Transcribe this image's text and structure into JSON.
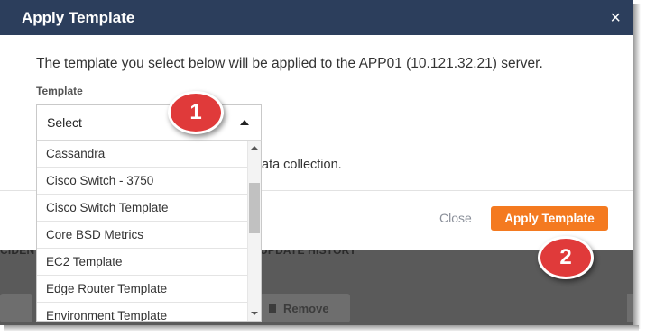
{
  "background": {
    "tab_left": "CIDENT",
    "tab_right": "UPDATE HISTORY",
    "remove_label": "Remove"
  },
  "dialog": {
    "title": "Apply Template",
    "close_icon": "×",
    "description": "The template you select below will be applied to the APP01 (10.121.32.21) server.",
    "field_label": "Template",
    "description_tail": "ata collection.",
    "close_label": "Close",
    "apply_label": "Apply Template",
    "accent_color": "#f47a20",
    "header_color": "#2c3e5c"
  },
  "select": {
    "value": "Select",
    "options": [
      "Cassandra",
      "Cisco Switch - 3750",
      "Cisco Switch Template",
      "Core BSD Metrics",
      "EC2 Template",
      "Edge Router Template",
      "Environment Template"
    ]
  },
  "callouts": {
    "step1": "1",
    "step2": "2",
    "color": "#e03a3a"
  }
}
